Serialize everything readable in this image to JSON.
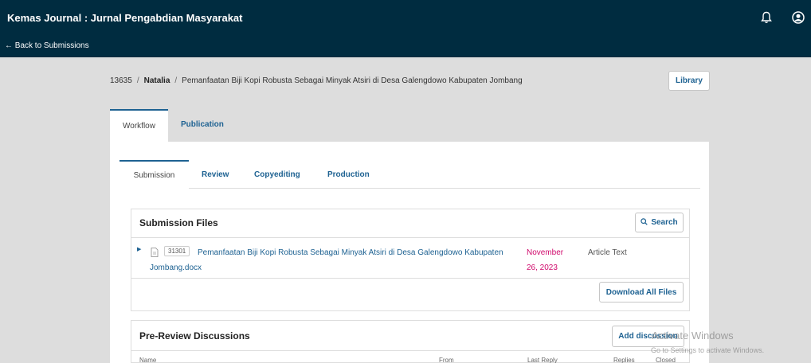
{
  "header": {
    "app_title": "Kemas Journal : Jurnal Pengabdian Masyarakat",
    "back_label": "← Back to Submissions",
    "icons": [
      "bell-icon",
      "user-icon"
    ],
    "colors": {
      "bar": "#002c40",
      "link": "#1e6292",
      "date": "#d00a6c"
    }
  },
  "breadcrumb": {
    "id": "13635",
    "author": "Natalia",
    "title": "Pemanfaatan Biji Kopi Robusta Sebagai Minyak Atsiri di Desa Galengdowo Kabupaten Jombang",
    "sep": "/"
  },
  "library_label": "Library",
  "main_tabs": [
    {
      "label": "Workflow",
      "active": true
    },
    {
      "label": "Publication",
      "active": false
    }
  ],
  "stage_tabs": [
    {
      "label": "Submission",
      "active": true
    },
    {
      "label": "Review",
      "active": false
    },
    {
      "label": "Copyediting",
      "active": false
    },
    {
      "label": "Production",
      "active": false
    }
  ],
  "submission_files": {
    "title": "Submission Files",
    "search_label": "Search",
    "files": [
      {
        "id": "31301",
        "name": "Pemanfaatan Biji Kopi Robusta Sebagai Minyak Atsiri di Desa Galengdowo Kabupaten Jombang.docx",
        "date": "November 26, 2023",
        "type": "Article Text"
      }
    ],
    "download_label": "Download All Files"
  },
  "discussions": {
    "title": "Pre-Review Discussions",
    "add_label": "Add discussion",
    "columns": [
      "Name",
      "From",
      "Last Reply",
      "Replies",
      "Closed"
    ]
  },
  "watermark": {
    "line1": "Activate Windows",
    "line2": "Go to Settings to activate Windows."
  }
}
